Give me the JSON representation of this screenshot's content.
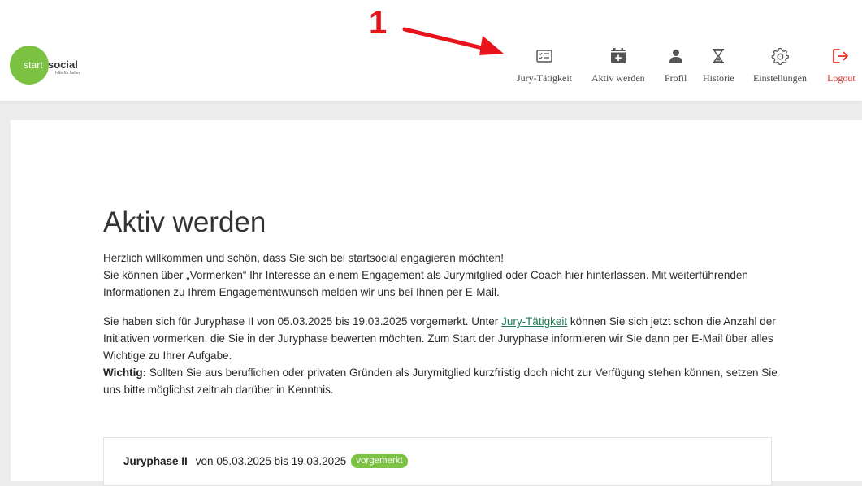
{
  "logo": {
    "start": "start",
    "social": "social",
    "tagline": "hilfe für helfer"
  },
  "annotation": {
    "number": "1"
  },
  "nav": [
    {
      "label": "Jury-Tätigkeit",
      "icon": "checklist-icon"
    },
    {
      "label": "Aktiv werden",
      "icon": "calendar-plus-icon"
    },
    {
      "label": "Profil",
      "icon": "person-icon"
    },
    {
      "label": "Historie",
      "icon": "hourglass-icon"
    },
    {
      "label": "Einstellungen",
      "icon": "gear-icon"
    },
    {
      "label": "Logout",
      "icon": "logout-icon"
    }
  ],
  "main": {
    "title": "Aktiv werden",
    "intro_line1": "Herzlich willkommen und schön, dass Sie sich bei startsocial engagieren möchten!",
    "intro_line2": "Sie können über „Vormerken“ Ihr Interesse an einem Engagement als Jurymitglied oder Coach hier hinterlassen. Mit weiterführenden Informationen zu Ihrem Engagementwunsch melden wir uns bei Ihnen per E-Mail.",
    "para2_before": "Sie haben sich für Juryphase II von 05.03.2025 bis 19.03.2025 vorgemerkt. Unter ",
    "para2_link": "Jury-Tätigkeit",
    "para2_after": " können Sie sich jetzt schon die Anzahl der Initiativen vormerken, die Sie in der Juryphase bewerten möchten. Zum Start der Juryphase informieren wir Sie dann per E-Mail über alles Wichtige zu Ihrer Aufgabe.",
    "important_label": "Wichtig:",
    "important_text": " Sollten Sie aus beruflichen oder privaten Gründen als Jurymitglied kurzfristig doch nicht zur Verfügung stehen können, setzen Sie uns bitte möglichst zeitnah darüber in Kenntnis."
  },
  "phase": {
    "name": "Juryphase II",
    "dates": "von 05.03.2025 bis 19.03.2025",
    "status": "vorgemerkt"
  },
  "colors": {
    "brand_green": "#7cc242",
    "logout_red": "#e5322d",
    "annotation_red": "#e8131b",
    "link_green": "#1c7a55"
  }
}
